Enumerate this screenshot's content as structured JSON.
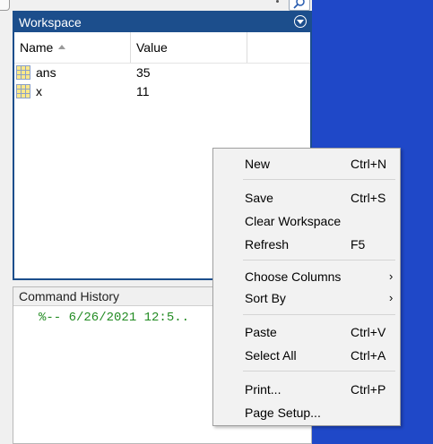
{
  "workspace": {
    "title": "Workspace",
    "columns": {
      "name": "Name",
      "value": "Value"
    },
    "rows": [
      {
        "name": "ans",
        "value": "35"
      },
      {
        "name": "x",
        "value": "11"
      }
    ]
  },
  "command_history": {
    "title": "Command History",
    "entry": "%-- 6/26/2021 12:5.."
  },
  "context_menu": {
    "new": {
      "label": "New",
      "shortcut": "Ctrl+N"
    },
    "save": {
      "label": "Save",
      "shortcut": "Ctrl+S"
    },
    "clear_workspace": {
      "label": "Clear Workspace"
    },
    "refresh": {
      "label": "Refresh",
      "shortcut": "F5"
    },
    "choose_columns": {
      "label": "Choose Columns",
      "submenu": "›"
    },
    "sort_by": {
      "label": "Sort By",
      "submenu": "›"
    },
    "paste": {
      "label": "Paste",
      "shortcut": "Ctrl+V"
    },
    "select_all": {
      "label": "Select All",
      "shortcut": "Ctrl+A"
    },
    "print": {
      "label": "Print...",
      "shortcut": "Ctrl+P"
    },
    "page_setup": {
      "label": "Page Setup..."
    }
  },
  "colors": {
    "panel_title_bg": "#1c4e8c",
    "desktop_bg": "#1f48c8",
    "history_text": "#228b22"
  },
  "icons": [
    "workspace-menu-icon",
    "sort-ascending-icon",
    "matrix-variable-icon",
    "submenu-arrow-icon",
    "search-icon"
  ]
}
